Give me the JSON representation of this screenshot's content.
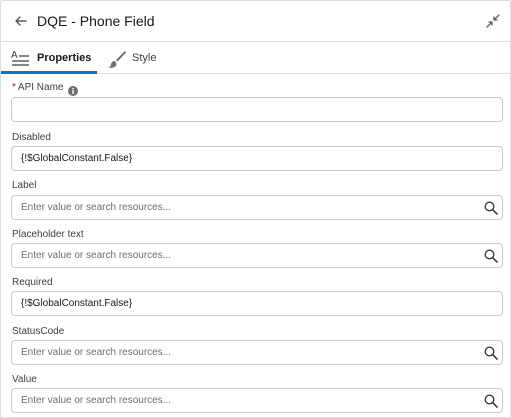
{
  "header": {
    "title": "DQE - Phone Field"
  },
  "tabs": [
    {
      "label": "Properties",
      "selected": true
    },
    {
      "label": "Style",
      "selected": false
    }
  ],
  "fields": {
    "api_name": {
      "label": "API Name",
      "required": true,
      "value": ""
    },
    "disabled": {
      "label": "Disabled",
      "value": "{!$GlobalConstant.False}"
    },
    "label": {
      "label": "Label",
      "placeholder": "Enter value or search resources..."
    },
    "placeholder_text": {
      "label": "Placeholder text",
      "placeholder": "Enter value or search resources..."
    },
    "required": {
      "label": "Required",
      "value": "{!$GlobalConstant.False}"
    },
    "status_code": {
      "label": "StatusCode",
      "placeholder": "Enter value or search resources..."
    },
    "value": {
      "label": "Value",
      "placeholder": "Enter value or search resources..."
    }
  },
  "colors": {
    "accent": "#0176d3",
    "required_star": "#ba0517",
    "border": "#c9c9c9"
  },
  "icons": [
    "back-arrow-icon",
    "expand-icon",
    "properties-icon",
    "brush-icon",
    "info-icon",
    "search-icon"
  ]
}
